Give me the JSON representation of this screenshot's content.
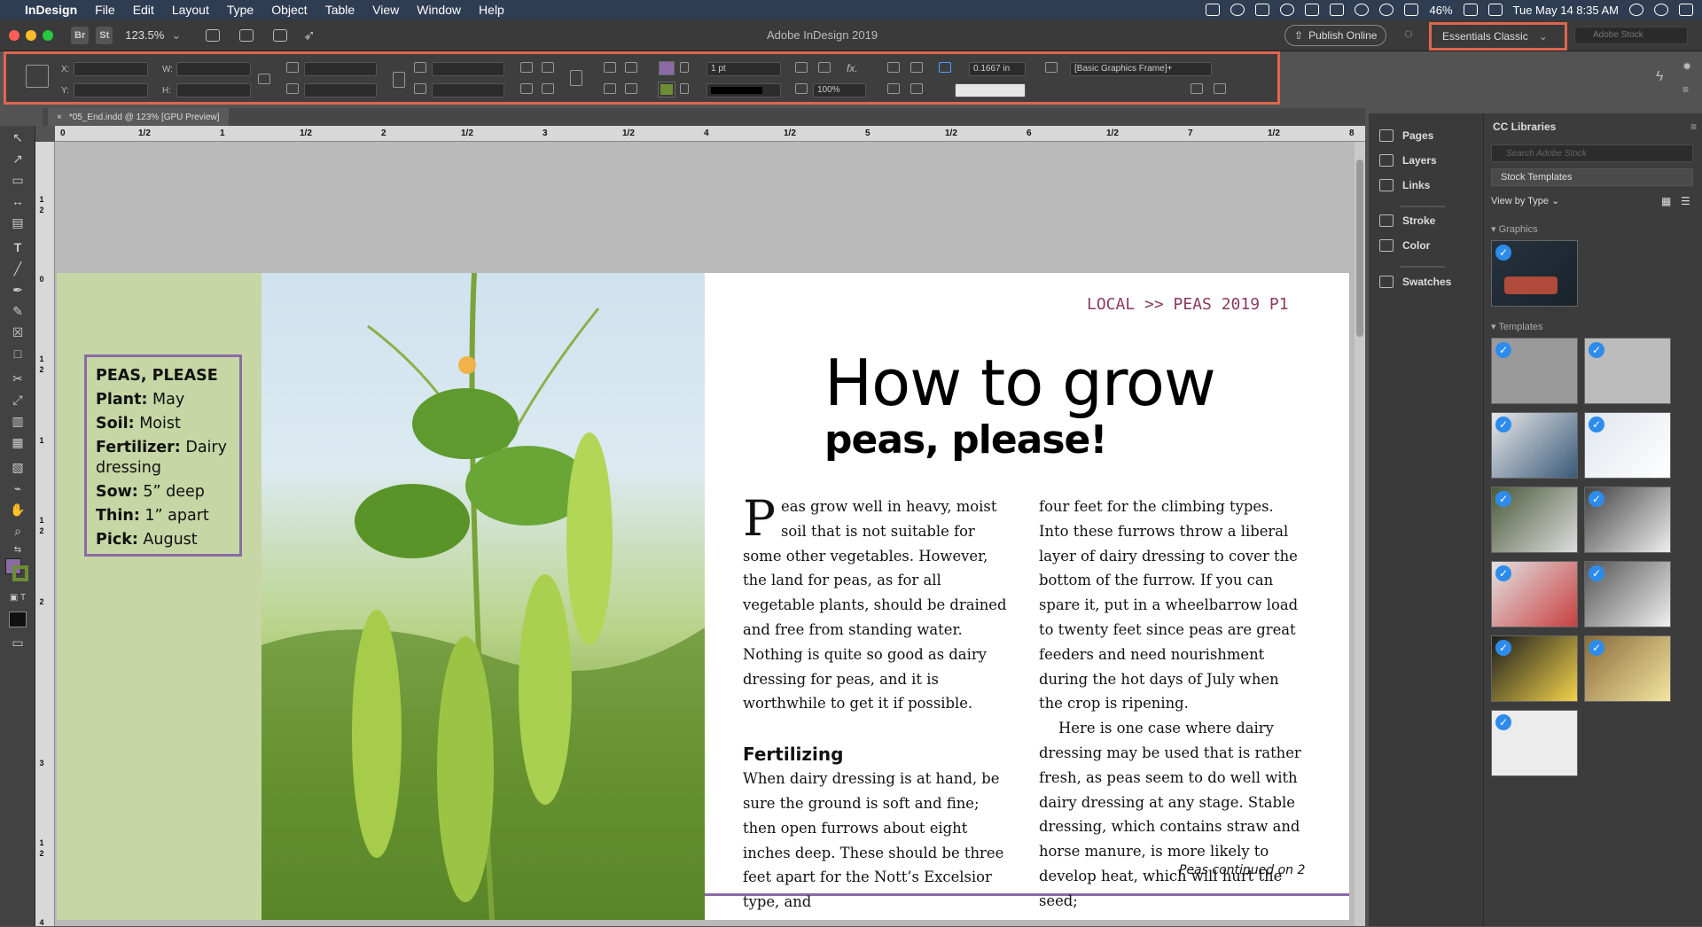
{
  "menubar": {
    "app": "InDesign",
    "items": [
      "File",
      "Edit",
      "Layout",
      "Type",
      "Object",
      "Table",
      "View",
      "Window",
      "Help"
    ],
    "battery": "46%",
    "datetime": "Tue May 14  8:35 AM"
  },
  "titlebar": {
    "bridge": "Br",
    "stock": "St",
    "zoom": "123.5%",
    "title": "Adobe InDesign 2019",
    "publish": "Publish Online",
    "workspace": "Essentials Classic",
    "search_placeholder": "Adobe Stock"
  },
  "control": {
    "x_label": "X:",
    "y_label": "Y:",
    "w_label": "W:",
    "h_label": "H:",
    "stroke_weight": "1 pt",
    "scale": "100%",
    "offset": "0.1667 in",
    "object_style": "[Basic Graphics Frame]+"
  },
  "document_tab": "*05_End.indd @ 123% [GPU Preview]",
  "ruler": {
    "h": [
      "0",
      "1/2",
      "1",
      "1/2",
      "2",
      "1/2",
      "3",
      "1/2",
      "4",
      "1/2",
      "5",
      "1/2",
      "6",
      "1/2",
      "7",
      "1/2",
      "8"
    ],
    "v": [
      "1",
      "2",
      "0",
      "1",
      "2",
      "1",
      "1",
      "2",
      "2",
      "3",
      "1",
      "2",
      "4"
    ]
  },
  "page": {
    "running_head": "LOCAL >> PEAS 2019  P1",
    "headline1": "How to grow",
    "headline2": "peas, please!",
    "dropcap": "P",
    "col1_p1": "eas grow well in heavy, moist soil that is not suitable for some other vegetables. However, the land for peas, as for all vegetable plants, should be drained and free from standing water. Nothing is quite so good as dairy dressing for peas, and it is worthwhile to get it if possible.",
    "subhead": "Fertilizing",
    "col1_p2": "When dairy dressing is at hand, be sure the ground is soft and fine; then open furrows about eight inches deep. These should be three feet apart for the Nott’s Excelsior type, and",
    "col2_p1": "four feet for the climbing types. Into these furrows throw a liberal layer of dairy dressing to cover the bottom of the furrow. If you can spare it, put in a wheelbarrow load to twenty feet since peas are great feeders and need nourishment during the hot days of July when the crop is ripening.",
    "col2_p2": "Here is one case where dairy dressing may be used that is rather fresh, as peas seem to do well with dairy dressing at any stage. Stable dressing, which contains straw and horse manure, is more likely to develop heat, which will hurt the seed;",
    "continued": "Peas continued on 2",
    "info": {
      "title": "PEAS, PLEASE",
      "rows": [
        {
          "label": "Plant:",
          "value": " May"
        },
        {
          "label": "Soil:",
          "value": " Moist"
        },
        {
          "label": "Fertilizer:",
          "value": " Dairy dressing"
        },
        {
          "label": "Sow:",
          "value": " 5” deep"
        },
        {
          "label": "Thin:",
          "value": " 1” apart"
        },
        {
          "label": "Pick:",
          "value": " August"
        }
      ]
    }
  },
  "panels": [
    "Pages",
    "Layers",
    "Links",
    "Stroke",
    "Color",
    "Swatches"
  ],
  "cclib": {
    "title": "CC Libraries",
    "search_placeholder": "Search Adobe Stock",
    "source": "Stock Templates",
    "view": "View by Type",
    "graphics": "Graphics",
    "templates": "Templates"
  },
  "colors": {
    "accent": "#e0664f",
    "purple": "#8a6ba6",
    "green": "#c6d6a4",
    "running_head": "#8a3a5e",
    "check": "#2d8ceb"
  }
}
